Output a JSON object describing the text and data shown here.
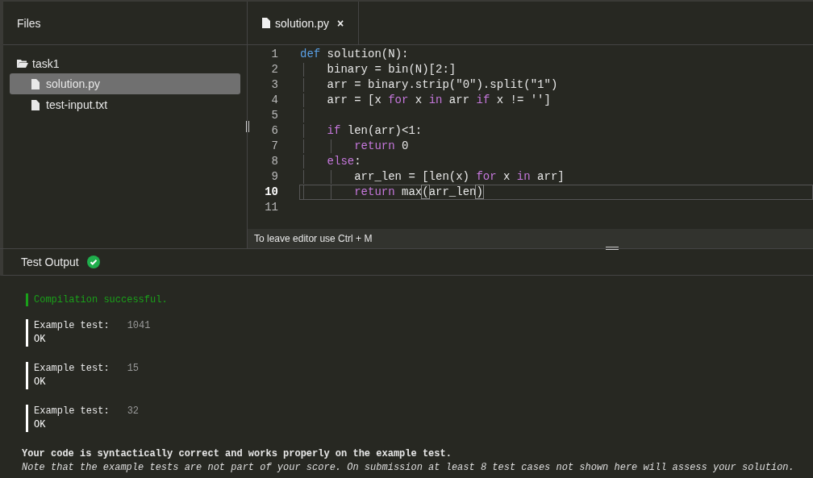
{
  "files": {
    "title": "Files",
    "folder": {
      "name": "task1",
      "items": [
        {
          "name": "solution.py",
          "selected": true
        },
        {
          "name": "test-input.txt",
          "selected": false
        }
      ]
    }
  },
  "editor": {
    "tabs": [
      {
        "label": "solution.py",
        "close": "×",
        "selected": true
      }
    ],
    "lines": [
      {
        "number": "1",
        "current": false,
        "tokens": [
          {
            "text": "def",
            "kind": "def"
          },
          {
            "text": " solution(N):",
            "kind": "plain"
          }
        ],
        "children": [
          {
            "number": "2",
            "current": false,
            "tokens": [
              {
                "text": "binary = bin(N)[2:]",
                "kind": "plain"
              }
            ]
          },
          {
            "number": "3",
            "current": false,
            "tokens": [
              {
                "text": "arr = binary.strip(",
                "kind": "plain"
              },
              {
                "text": "\"0\"",
                "kind": "str"
              },
              {
                "text": ").split(",
                "kind": "plain"
              },
              {
                "text": "\"1\"",
                "kind": "str"
              },
              {
                "text": ")",
                "kind": "plain"
              }
            ]
          },
          {
            "number": "4",
            "current": false,
            "tokens": [
              {
                "text": "arr = [x ",
                "kind": "plain"
              },
              {
                "text": "for",
                "kind": "kw"
              },
              {
                "text": " x ",
                "kind": "plain"
              },
              {
                "text": "in",
                "kind": "kw"
              },
              {
                "text": " arr ",
                "kind": "plain"
              },
              {
                "text": "if",
                "kind": "kw"
              },
              {
                "text": " x != ",
                "kind": "plain"
              },
              {
                "text": "''",
                "kind": "str"
              },
              {
                "text": "]",
                "kind": "plain"
              }
            ]
          },
          {
            "number": "5",
            "current": false
          },
          {
            "number": "6",
            "current": false,
            "tokens": [
              {
                "text": "if",
                "kind": "kw"
              },
              {
                "text": " len(arr)<1:",
                "kind": "plain"
              }
            ],
            "children": [
              {
                "number": "7",
                "current": false,
                "tokens": [
                  {
                    "text": "return",
                    "kind": "kw"
                  },
                  {
                    "text": " 0",
                    "kind": "plain"
                  }
                ]
              }
            ]
          },
          {
            "number": "8",
            "current": false,
            "tokens": [
              {
                "text": "else",
                "kind": "kw"
              },
              {
                "text": ":",
                "kind": "plain"
              }
            ],
            "children": [
              {
                "number": "9",
                "current": false,
                "tokens": [
                  {
                    "text": "arr_len = [len(x) ",
                    "kind": "plain"
                  },
                  {
                    "text": "for",
                    "kind": "kw"
                  },
                  {
                    "text": " x ",
                    "kind": "plain"
                  },
                  {
                    "text": "in",
                    "kind": "kw"
                  },
                  {
                    "text": " arr]",
                    "kind": "plain"
                  }
                ]
              },
              {
                "number": "10",
                "current": true,
                "tokens": [
                  {
                    "text": "return",
                    "kind": "kw"
                  },
                  {
                    "text": " max",
                    "kind": "plain"
                  },
                  {
                    "text": "(",
                    "kind": "bracket"
                  },
                  {
                    "text": "arr_len",
                    "kind": "plain"
                  },
                  {
                    "text": ")",
                    "kind": "bracket"
                  }
                ]
              }
            ]
          }
        ]
      },
      {
        "number": "11",
        "current": false
      }
    ],
    "status": "To leave editor use Ctrl + M"
  },
  "output": {
    "title": "Test Output",
    "passed": true,
    "compilation": "Compilation successful.",
    "tests": [
      {
        "label": "Example test:",
        "value": "1041",
        "result": "OK"
      },
      {
        "label": "Example test:",
        "value": "15",
        "result": "OK"
      },
      {
        "label": "Example test:",
        "value": "32",
        "result": "OK"
      }
    ],
    "summary": "Your code is syntactically correct and works properly on the example test.",
    "note": "Note that the example tests are not part of your score. On submission at least 8 test cases not shown here will assess your solution."
  }
}
